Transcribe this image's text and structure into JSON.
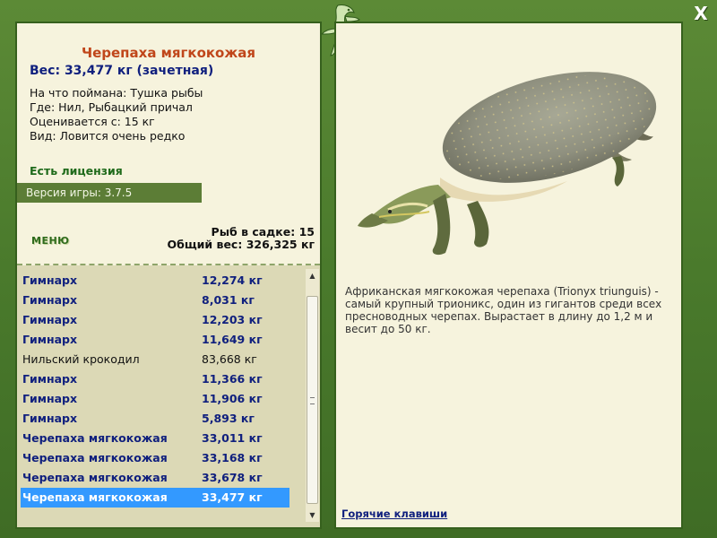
{
  "window": {
    "close_label": "X"
  },
  "fish": {
    "name": "Черепаха мягкокожая",
    "weight": "Вес: 33,477 кг (зачетная)",
    "caught_on": "На что поймана: Тушка рыбы",
    "location": "Где: Нил, Рыбацкий причал",
    "valued_from": "Оценивается с: 15 кг",
    "rarity": "Вид: Ловится очень редко"
  },
  "license": "Есть лицензия",
  "version": "Версия игры: 3.7.5",
  "menu_label": "МЕНЮ",
  "stats": {
    "count": "Рыб в садке: 15",
    "total": "Общий вес: 326,325 кг"
  },
  "catch_list": [
    {
      "name": "Гимнарх",
      "weight": "12,274 кг",
      "trophy": true
    },
    {
      "name": "Гимнарх",
      "weight": "8,031 кг",
      "trophy": true
    },
    {
      "name": "Гимнарх",
      "weight": "12,203 кг",
      "trophy": true
    },
    {
      "name": "Гимнарх",
      "weight": "11,649 кг",
      "trophy": true
    },
    {
      "name": "Нильский крокодил",
      "weight": "83,668 кг",
      "trophy": false
    },
    {
      "name": "Гимнарх",
      "weight": "11,366 кг",
      "trophy": true
    },
    {
      "name": "Гимнарх",
      "weight": "11,906 кг",
      "trophy": true
    },
    {
      "name": "Гимнарх",
      "weight": "5,893 кг",
      "trophy": true
    },
    {
      "name": "Черепаха мягкокожая",
      "weight": "33,011 кг",
      "trophy": true
    },
    {
      "name": "Черепаха мягкокожая",
      "weight": "33,168 кг",
      "trophy": true
    },
    {
      "name": "Черепаха мягкокожая",
      "weight": "33,678 кг",
      "trophy": true
    },
    {
      "name": "Черепаха мягкокожая",
      "weight": "33,477 кг",
      "trophy": true,
      "selected": true
    }
  ],
  "description": "Африканская мягкокожая черепаха (Trionyx triunguis) - самый крупный трионикс, один из гигантов среди всех пресноводных черепах. Вырастает в длину до 1,2 м и весит до 50 кг.",
  "hotkeys_label": "Горячие клавиши",
  "icons": {
    "close": "close-icon",
    "logo": "lizard-logo-icon",
    "scroll_up": "scroll-up-arrow-icon",
    "scroll_down": "scroll-down-arrow-icon"
  },
  "colors": {
    "frame": "#4b7a2e",
    "panel": "#f6f3dd",
    "list_bg": "#dcd9b6",
    "trophy_text": "#10207e",
    "fish_title": "#c0461a",
    "selection": "#3399ff"
  }
}
